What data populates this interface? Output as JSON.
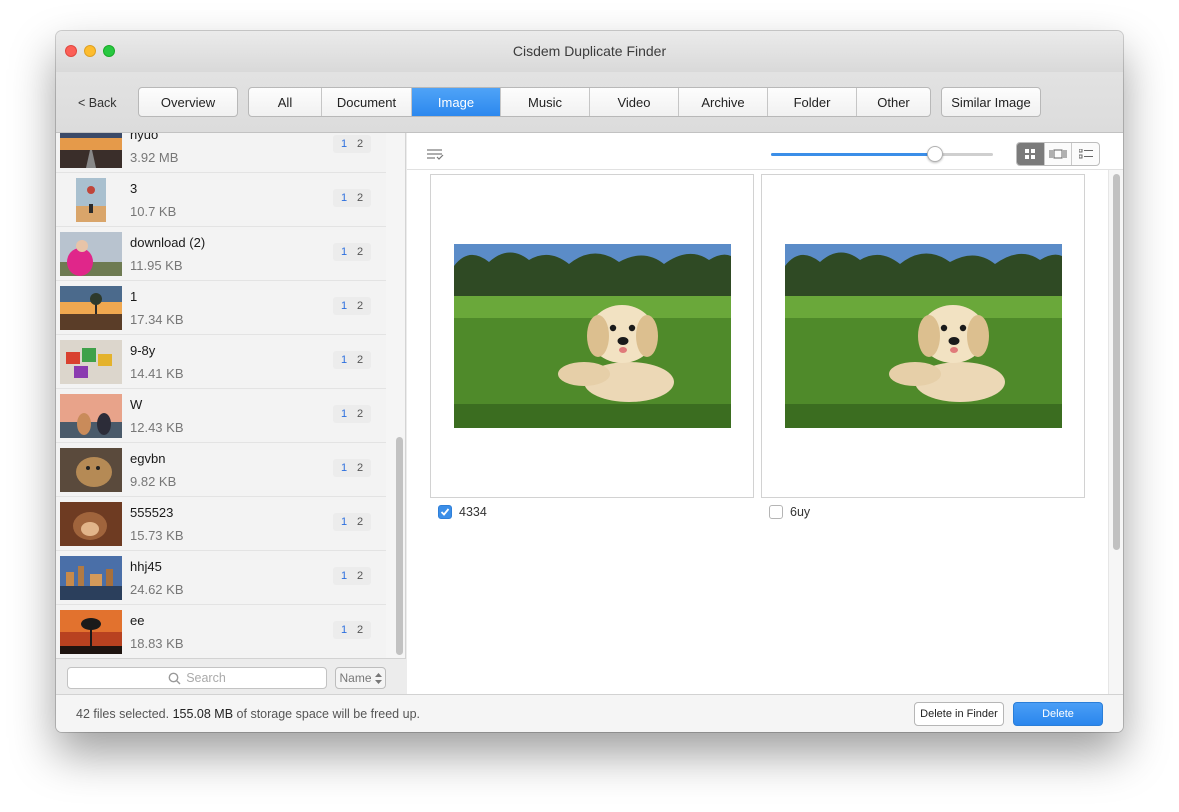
{
  "window": {
    "title": "Cisdem Duplicate Finder"
  },
  "toolbar": {
    "back_label": "< Back",
    "overview_label": "Overview",
    "tabs": [
      "All",
      "Document",
      "Image",
      "Music",
      "Video",
      "Archive",
      "Folder",
      "Other"
    ],
    "active_tab": "Image",
    "similar_label": "Similar Image"
  },
  "sidebar": {
    "items": [
      {
        "name": "nyuo",
        "size": "3.92 MB",
        "count_a": "1",
        "count_b": "2",
        "thumb": "sunset-road"
      },
      {
        "name": "3",
        "size": "10.7 KB",
        "count_a": "1",
        "count_b": "2",
        "thumb": "person-balloon"
      },
      {
        "name": "download (2)",
        "size": "11.95 KB",
        "count_a": "1",
        "count_b": "2",
        "thumb": "girl-pink-coat"
      },
      {
        "name": "1",
        "size": "17.34 KB",
        "count_a": "1",
        "count_b": "2",
        "thumb": "tree-sunset"
      },
      {
        "name": "9-8y",
        "size": "14.41 KB",
        "count_a": "1",
        "count_b": "2",
        "thumb": "colorful-cards"
      },
      {
        "name": "W",
        "size": "12.43 KB",
        "count_a": "1",
        "count_b": "2",
        "thumb": "couple-dog"
      },
      {
        "name": "egvbn",
        "size": "9.82 KB",
        "count_a": "1",
        "count_b": "2",
        "thumb": "lion-cub"
      },
      {
        "name": "555523",
        "size": "15.73 KB",
        "count_a": "1",
        "count_b": "2",
        "thumb": "monkey"
      },
      {
        "name": "hhj45",
        "size": "24.62 KB",
        "count_a": "1",
        "count_b": "2",
        "thumb": "city-river"
      },
      {
        "name": "ee",
        "size": "18.83 KB",
        "count_a": "1",
        "count_b": "2",
        "thumb": "tree-silhouette"
      }
    ],
    "search_placeholder": "Search",
    "sort_label": "Name"
  },
  "main": {
    "zoom_percent": 74,
    "cards": [
      {
        "label": "4334",
        "checked": true,
        "image": "puppy-grass"
      },
      {
        "label": "6uy",
        "checked": false,
        "image": "puppy-grass"
      }
    ]
  },
  "status": {
    "count_text": "42 files selected.",
    "size": "155.08 MB",
    "tail_text": "of storage space will be freed up.",
    "delete_finder_label": "Delete in Finder",
    "delete_label": "Delete"
  },
  "colors": {
    "accent": "#3b8ee8",
    "active_tab": "#2c88ee"
  }
}
